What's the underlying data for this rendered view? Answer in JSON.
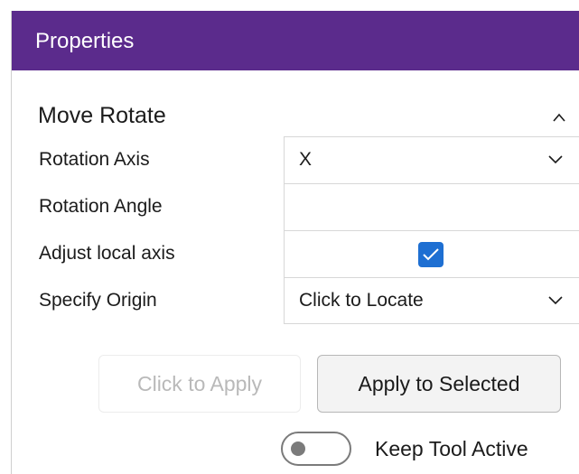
{
  "panel": {
    "header_title": "Properties",
    "header_color": "#5b2b8c"
  },
  "section": {
    "title": "Move Rotate",
    "collapse_icon": "chevron-up-icon"
  },
  "properties": [
    {
      "label": "Rotation Axis",
      "value": "X",
      "control": "dropdown"
    },
    {
      "label": "Rotation Angle",
      "value": "",
      "control": "text"
    },
    {
      "label": "Adjust local axis",
      "checked": true,
      "control": "checkbox"
    },
    {
      "label": "Specify Origin",
      "value": "Click to Locate",
      "control": "dropdown"
    }
  ],
  "buttons": {
    "click_to_apply": "Click to Apply",
    "apply_to_selected": "Apply to Selected"
  },
  "toggle": {
    "label": "Keep Tool Active",
    "on": false
  },
  "colors": {
    "accent": "#5b2b8c",
    "checkbox": "#1e6fd2"
  }
}
